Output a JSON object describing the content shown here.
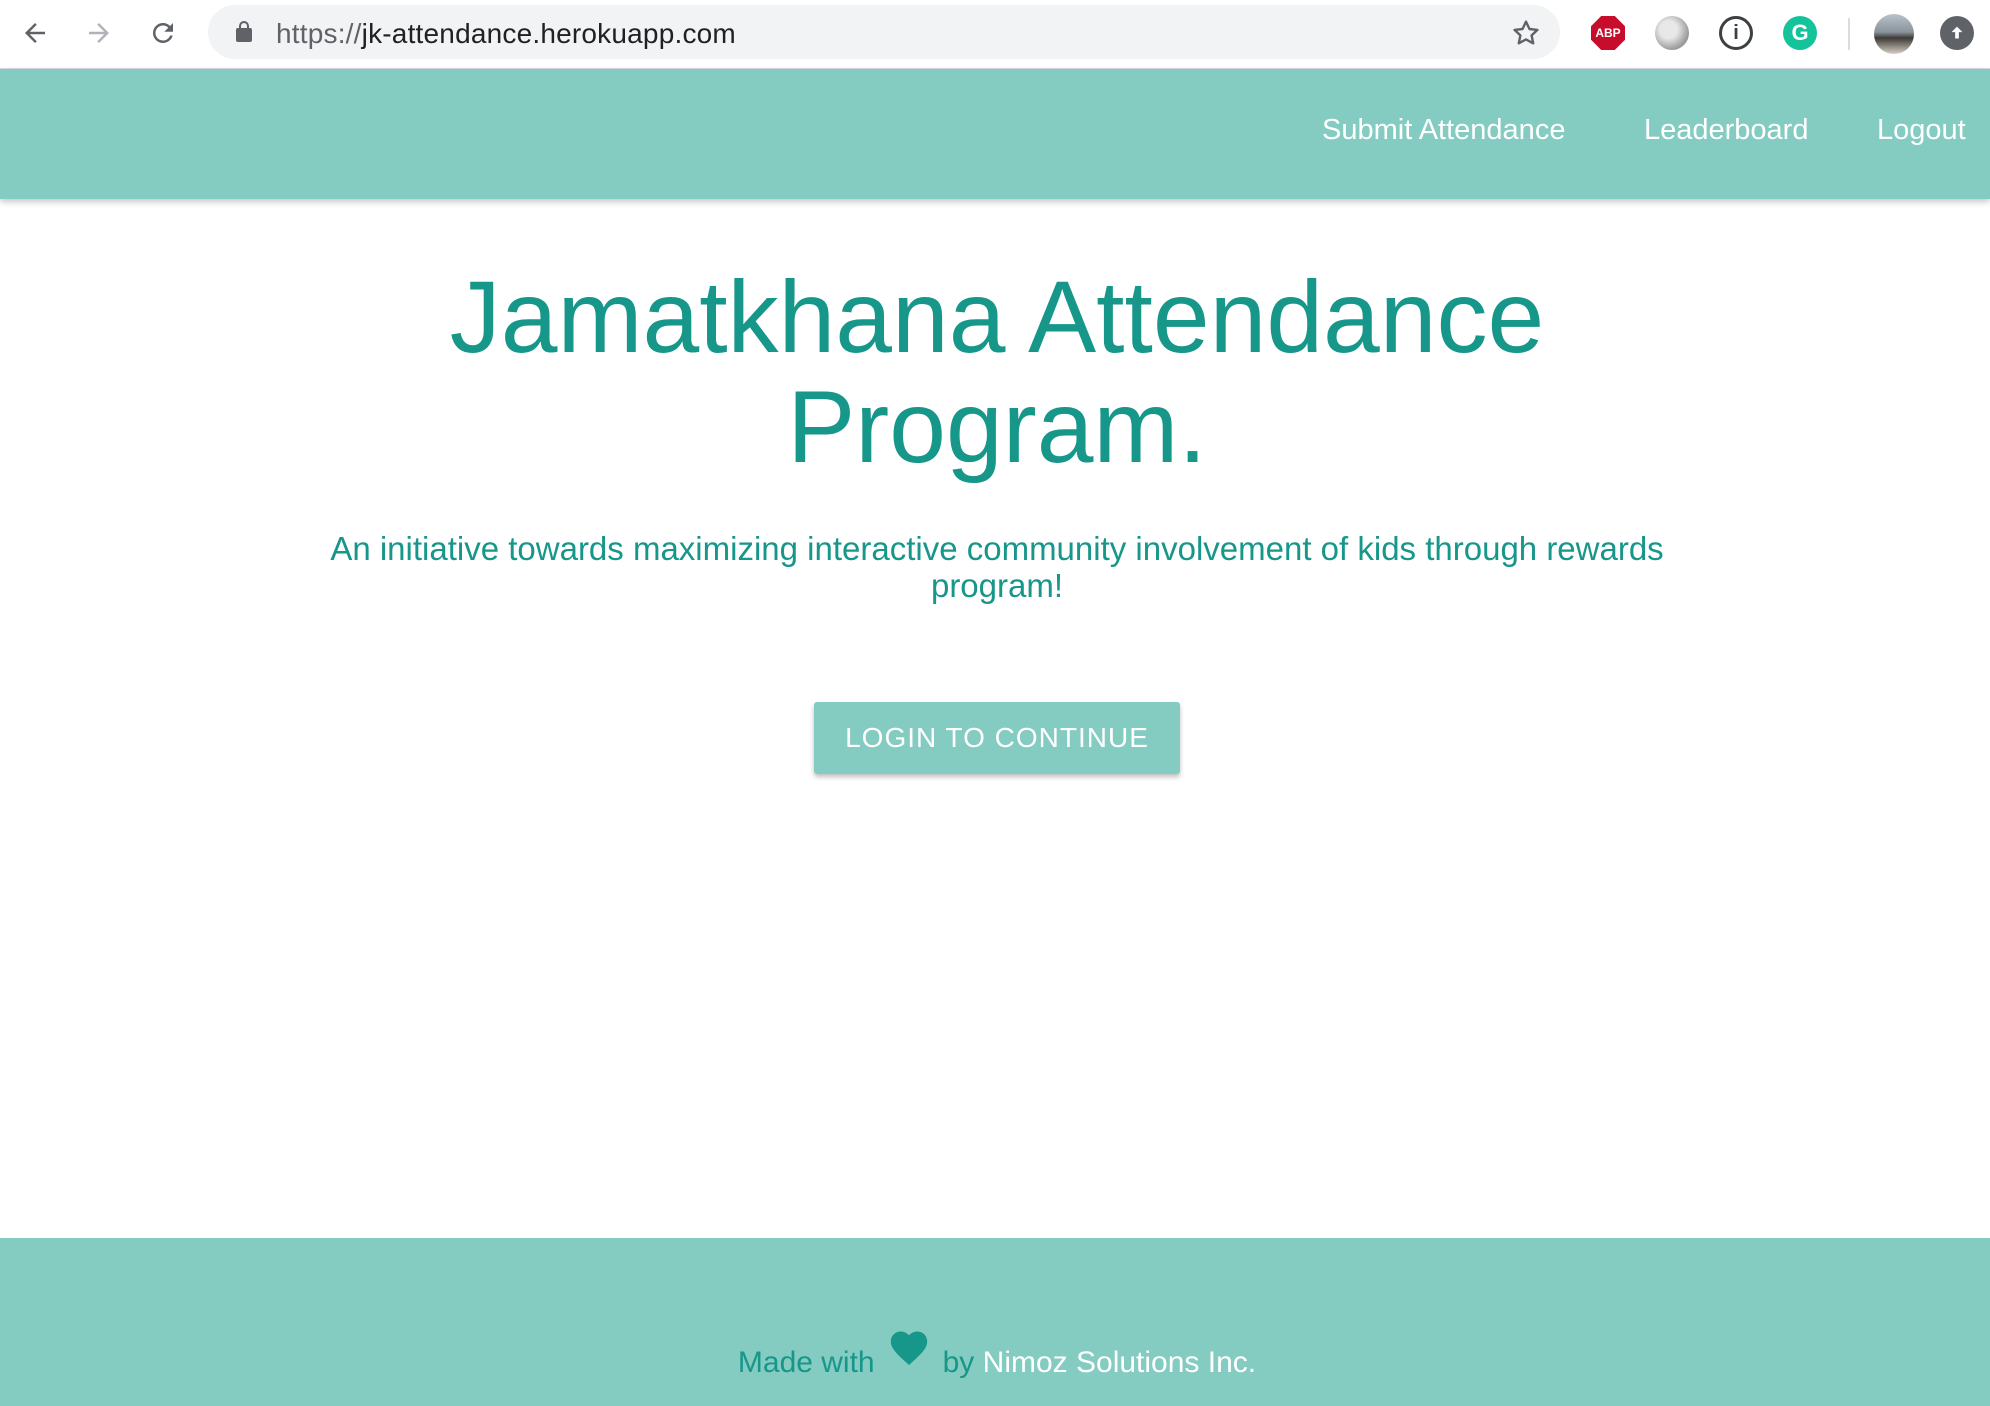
{
  "browser": {
    "url_scheme": "https://",
    "url_host": "jk-attendance.herokuapp.com",
    "icons": {
      "back": "arrow-back-icon",
      "forward": "arrow-forward-icon",
      "reload": "reload-icon",
      "lock": "lock-icon",
      "bookmark": "star-icon"
    },
    "extensions": {
      "abp_label": "ABP",
      "info_label": "i",
      "grammarly_label": "G"
    }
  },
  "navbar": {
    "links": [
      {
        "label": "Submit Attendance"
      },
      {
        "label": "Leaderboard"
      },
      {
        "label": "Logout"
      }
    ],
    "background": "#84cbc1"
  },
  "hero": {
    "title_line1": "Jamatkhana Attendance",
    "title_line2": "Program.",
    "subtitle": "An initiative towards maximizing interactive community involvement of kids through rewards program!",
    "cta_label": "LOGIN TO CONTINUE",
    "accent": "#17968a"
  },
  "footer": {
    "made_with": "Made with",
    "by": "by",
    "company": "Nimoz Solutions Inc.",
    "icon": "heart-icon"
  }
}
